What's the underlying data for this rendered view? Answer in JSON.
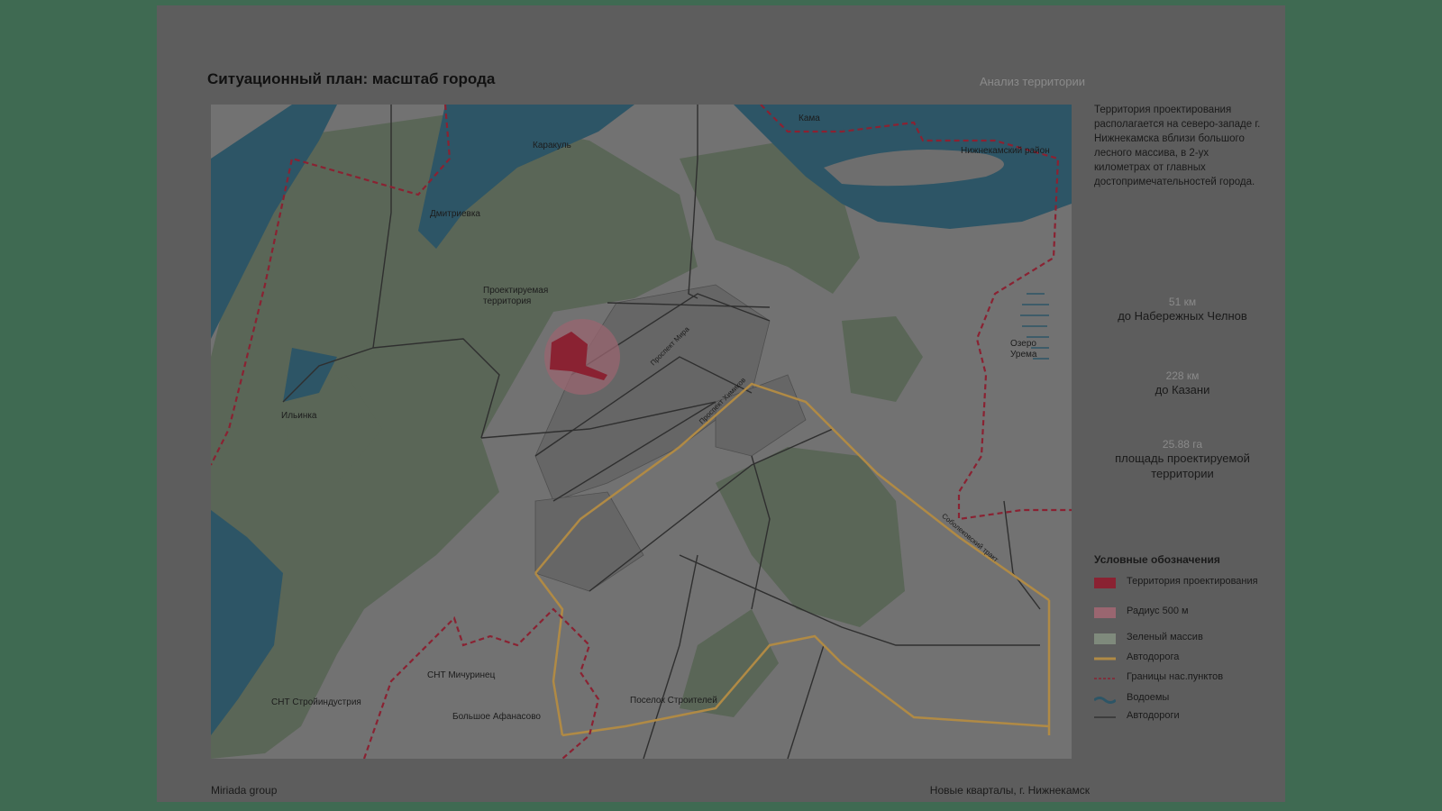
{
  "header": {
    "title": "Ситуационный план: масштаб города",
    "section": "Анализ территории"
  },
  "map": {
    "labels": {
      "kama": "Кама",
      "karakul": "Каракуль",
      "nizhnekamsk_district": "Нижнекамский район",
      "dmitrievka": "Дмитриевка",
      "project_area": "Проектируемая территория",
      "lake_urema": "Озеро Урема",
      "ilyinka": "Ильинка",
      "snt_michurinets": "СНТ Мичуринец",
      "snt_stroyindustriya": "СНТ Стройиндустрия",
      "bolshoe_afanasovo": "Большое Афанасово",
      "poselok_stroiteley": "Поселок Строителей",
      "sobolekovsky_trakt": "Соболековский тракт",
      "prospekt_mira": "Проспект Мира",
      "prospekt_himikov": "Проспект Химиков"
    }
  },
  "sidebar": {
    "description": "Территория проектирования располагается на северо-западе г. Нижнекамска вблизи большого лесного массива, в 2-ух километрах от главных достопримечательностей города.",
    "stats": [
      {
        "value": "51 км",
        "label": "до Набережных Челнов"
      },
      {
        "value": "228 км",
        "label": "до Казани"
      },
      {
        "value": "25.88 га",
        "label": "площадь проектируемой территории"
      }
    ]
  },
  "legend": {
    "title": "Условные обозначения",
    "items": [
      {
        "label": "Территория проектирования",
        "icon": "project-area-swatch",
        "color": "#8a2232"
      },
      {
        "label": "Радиус 500 м",
        "icon": "radius-swatch",
        "color": "#9a6670"
      },
      {
        "label": "Зеленый массив",
        "icon": "green-area-swatch",
        "color": "#7f8a7c"
      },
      {
        "label": "Автодорога",
        "icon": "highway-swatch",
        "color": "#b08a45"
      },
      {
        "label": "Границы нас.пунктов",
        "icon": "border-swatch",
        "color": "#8a2232"
      },
      {
        "label": "Водоемы",
        "icon": "water-swatch",
        "color": "#2d5566"
      },
      {
        "label": "Автодороги",
        "icon": "roads-swatch",
        "color": "#333333"
      }
    ]
  },
  "footer": {
    "left": "Miriada group",
    "right": "Новые кварталы, г. Нижнекамск"
  },
  "colors": {
    "page_background": "#3f6a52",
    "sheet": "#5d5d5d",
    "map_base": "#727272",
    "forest": "#5a6657",
    "water": "#2d5566",
    "highway": "#b08a45",
    "border": "#8a2232",
    "project_area": "#8a2232"
  }
}
